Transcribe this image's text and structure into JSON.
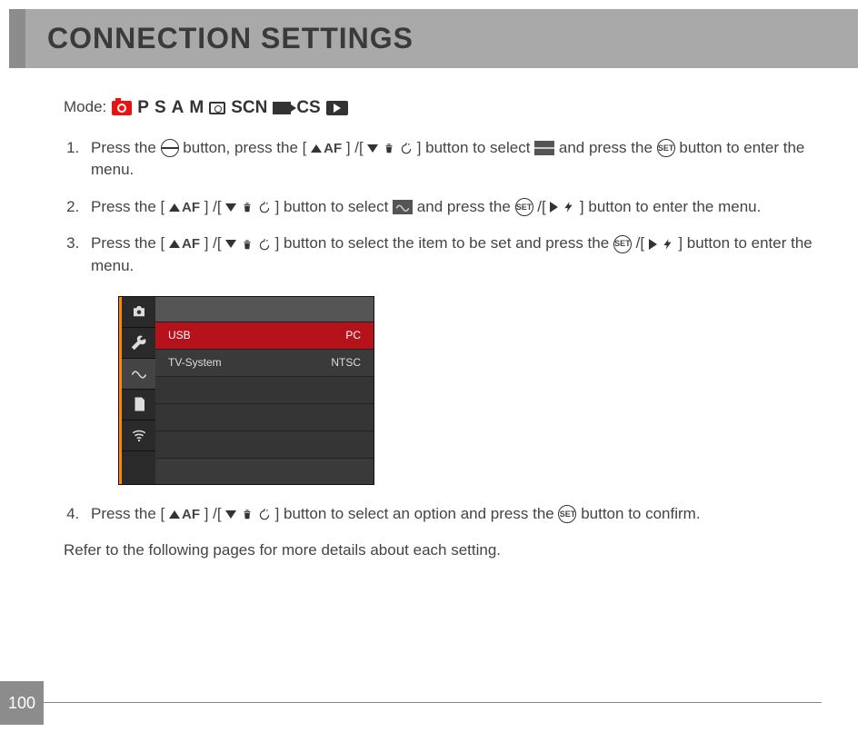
{
  "header": {
    "title": "CONNECTION SETTINGS"
  },
  "mode": {
    "label": "Mode:",
    "letters": {
      "p": "P",
      "s": "S",
      "a": "A",
      "m": "M",
      "scn": "SCN",
      "cs": "CS"
    }
  },
  "steps": {
    "s1_a": "Press the ",
    "s1_b": " button, press the [",
    "s1_af": "AF",
    "s1_c": "] /[",
    "s1_d": "] button to select ",
    "s1_e": " and press the ",
    "s1_f": " button to enter the menu.",
    "s2_a": "Press the [",
    "s2_b": "] /[",
    "s2_c": "] button to select ",
    "s2_d": " and press the ",
    "s2_e": " /[",
    "s2_f": "] button to enter the menu.",
    "s3_a": "Press the [",
    "s3_b": "] /[",
    "s3_c": "] button to select the item to be set and press the ",
    "s3_d": " /[",
    "s3_e": "] button to enter the menu.",
    "s4_a": "Press the [",
    "s4_b": "] /[",
    "s4_c": "] button to select an option and press the ",
    "s4_d": " button to confirm."
  },
  "menu": {
    "rows": [
      {
        "label": "USB",
        "value": "PC",
        "selected": true
      },
      {
        "label": "TV-System",
        "value": "NTSC",
        "selected": false
      }
    ]
  },
  "footnote": "Refer to the following pages for more details about each setting.",
  "page": "100",
  "set_label": "SET"
}
